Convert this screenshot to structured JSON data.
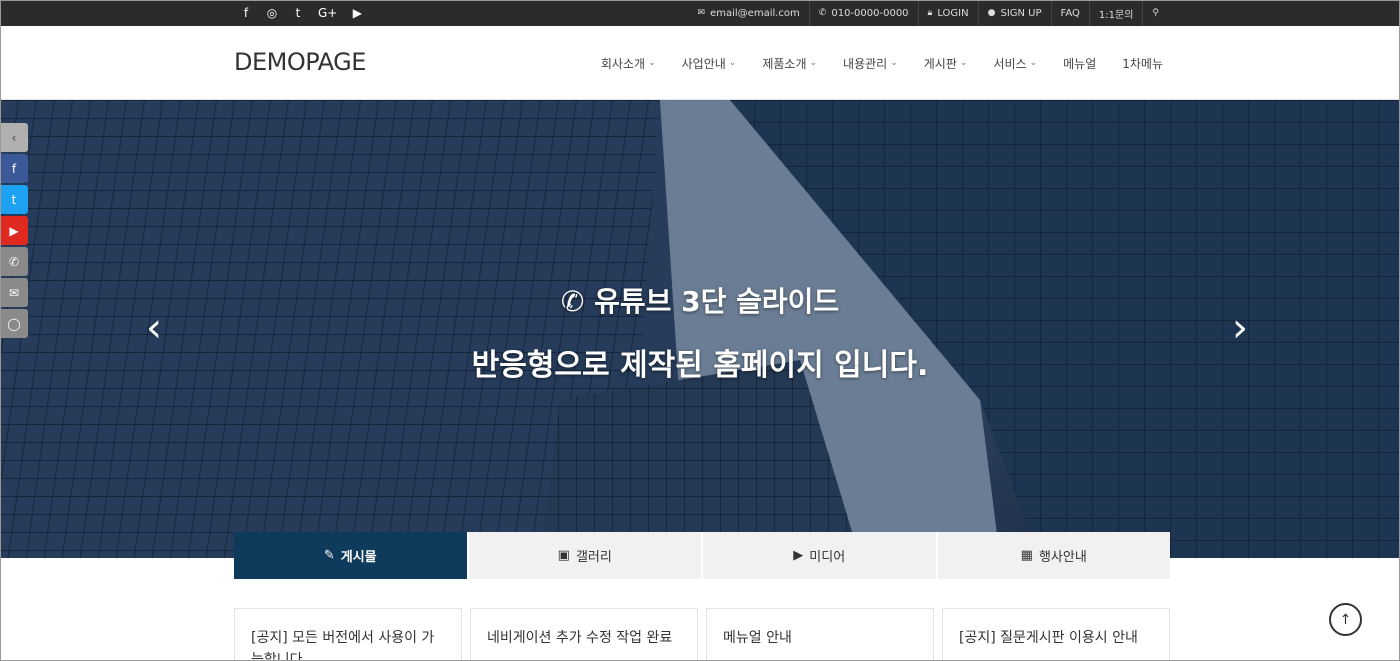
{
  "topbar": {
    "social_icons": [
      {
        "name": "facebook-icon",
        "glyph": "f"
      },
      {
        "name": "instagram-icon",
        "glyph": "◎"
      },
      {
        "name": "twitter-icon",
        "glyph": "🐦"
      },
      {
        "name": "google-plus-icon",
        "glyph": "G+"
      },
      {
        "name": "youtube-icon",
        "glyph": "▶"
      }
    ],
    "email": "email@email.com",
    "phone": "010-0000-0000",
    "login": "LOGIN",
    "signup": "SIGN UP",
    "faq": "FAQ",
    "inquiry": "1:1문의"
  },
  "header": {
    "logo": "DEMOPAGE",
    "nav": [
      {
        "label": "회사소개",
        "has_dropdown": true
      },
      {
        "label": "사업안내",
        "has_dropdown": true
      },
      {
        "label": "제품소개",
        "has_dropdown": true
      },
      {
        "label": "내용관리",
        "has_dropdown": true
      },
      {
        "label": "게시판",
        "has_dropdown": true
      },
      {
        "label": "서비스",
        "has_dropdown": true
      },
      {
        "label": "메뉴얼",
        "has_dropdown": false
      },
      {
        "label": "1차메뉴",
        "has_dropdown": false
      }
    ]
  },
  "hero": {
    "caption_line1": "유튜브 3단 슬라이드",
    "caption_line2": "반응형으로 제작된 홈페이지 입니다."
  },
  "float_side": [
    {
      "name": "collapse-arrow-icon",
      "glyph": "‹",
      "color": "#b0b0b0"
    },
    {
      "name": "facebook-icon",
      "glyph": "f",
      "color": "#3b5998"
    },
    {
      "name": "twitter-icon",
      "glyph": "t",
      "color": "#1da1f2"
    },
    {
      "name": "youtube-icon",
      "glyph": "▶",
      "color": "#e02a20"
    },
    {
      "name": "phone-icon",
      "glyph": "✆",
      "color": "#8a8a8a"
    },
    {
      "name": "mail-icon",
      "glyph": "✉",
      "color": "#8a8a8a"
    },
    {
      "name": "user-icon",
      "glyph": "◯",
      "color": "#8a8a8a"
    }
  ],
  "tabs": [
    {
      "label": "게시물",
      "icon": "post-icon",
      "glyph": "✎"
    },
    {
      "label": "갤러리",
      "icon": "gallery-icon",
      "glyph": "▣"
    },
    {
      "label": "미디어",
      "icon": "media-icon",
      "glyph": "▶"
    },
    {
      "label": "행사안내",
      "icon": "calendar-icon",
      "glyph": "▦"
    }
  ],
  "cards": [
    "[공지] 모든 버전에서 사용이 가능합니다",
    "네비게이션 추가 수정 작업 완료",
    "메뉴얼 안내",
    "[공지] 질문게시판 이용시 안내"
  ],
  "colors": {
    "topbar_bg": "#2b2b2b",
    "active_tab_bg": "#0e3a5c",
    "facebook": "#3b5998",
    "twitter": "#1da1f2",
    "youtube": "#e02a20"
  }
}
